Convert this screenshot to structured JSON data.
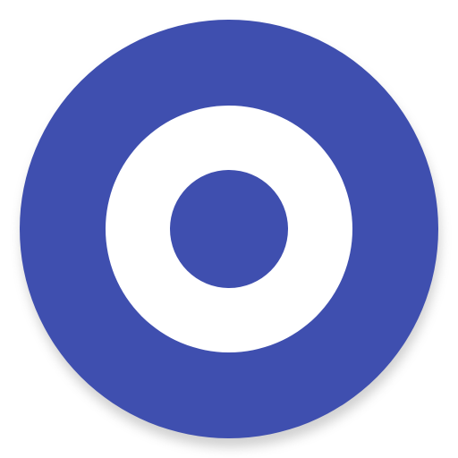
{
  "icon": {
    "name": "target-icon",
    "colors": {
      "outer_circle": "#3F4FAF",
      "ring": "#FFFFFF",
      "center_dot": "#3F4FAF",
      "shadow": "#9A9A9A",
      "background": "#FFFFFF"
    }
  }
}
